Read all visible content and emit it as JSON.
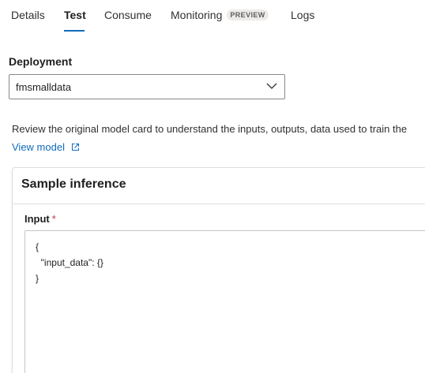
{
  "tabs": [
    {
      "label": "Details"
    },
    {
      "label": "Test"
    },
    {
      "label": "Consume"
    },
    {
      "label": "Monitoring",
      "badge": "PREVIEW"
    },
    {
      "label": "Logs"
    }
  ],
  "deployment": {
    "label": "Deployment",
    "value": "fmsmalldata"
  },
  "info": {
    "text": "Review the original model card to understand the inputs, outputs, data used to train the",
    "link": "View model"
  },
  "sample_inference": {
    "title": "Sample inference",
    "input_label": "Input",
    "required_mark": "*",
    "code_lines": [
      "{",
      "  \"input_data\": {}",
      "}"
    ]
  },
  "colors": {
    "accent": "#0f6cbd",
    "required": "#c4314b"
  }
}
